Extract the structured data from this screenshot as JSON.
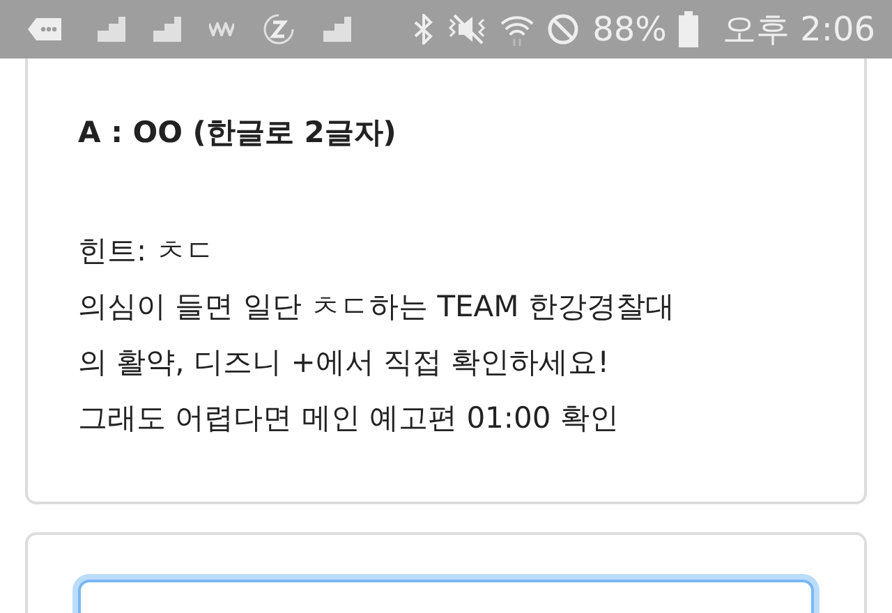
{
  "status_bar": {
    "battery": "88%",
    "time": "오후 2:06"
  },
  "question_card": {
    "title": "A : OO (한글로 2글자)",
    "hint_lines": [
      "힌트: ㅊㄷ",
      "의심이 들면 일단 ㅊㄷ하는 TEAM 한강경찰대",
      "의 활약, 디즈니 +에서 직접 확인하세요!",
      "그래도 어렵다면 메인 예고편 01:00 확인"
    ]
  },
  "answer_card": {
    "field": {
      "focused": true
    }
  }
}
